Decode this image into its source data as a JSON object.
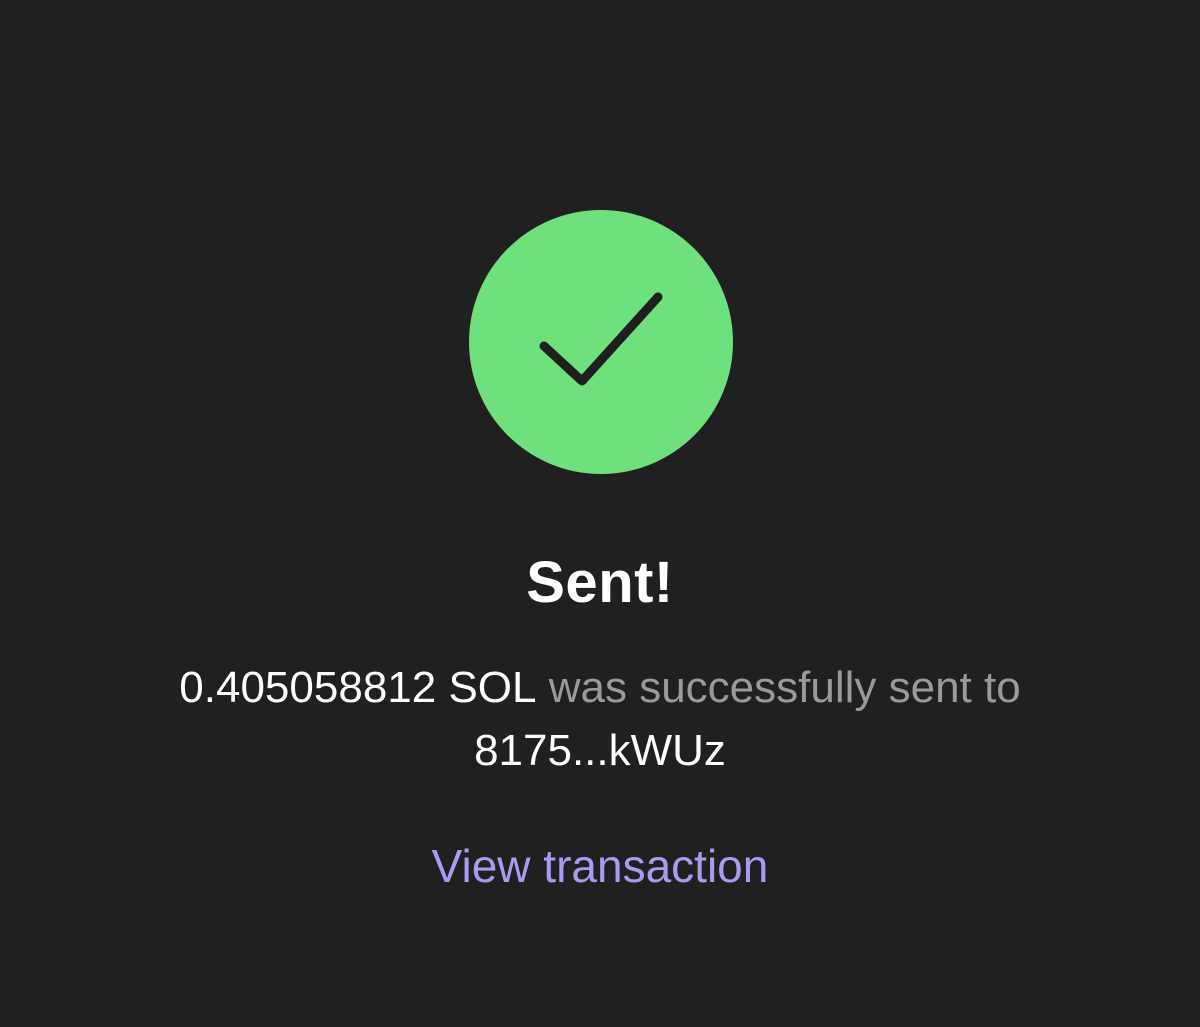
{
  "status": {
    "icon": "checkmark-icon",
    "circle_color": "#6ee07c",
    "title": "Sent!"
  },
  "message": {
    "amount": "0.405058812 SOL",
    "middle_text": " was successfully sent to ",
    "recipient": "8175...kWUz"
  },
  "actions": {
    "view_transaction_label": "View transaction",
    "link_color": "#a99cf0"
  }
}
